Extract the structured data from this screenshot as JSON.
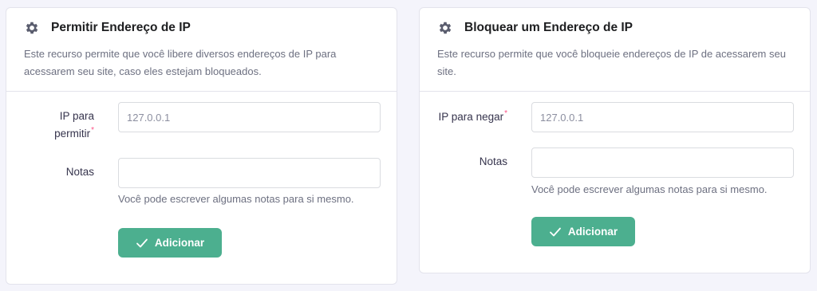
{
  "allow": {
    "title": "Permitir Endereço de IP",
    "description": "Este recurso permite que você libere diversos endereços de IP para acessarem seu site, caso eles estejam bloqueados.",
    "ip_label_line1": "IP para",
    "ip_label_line2": "permitir",
    "required_mark": "*",
    "ip_placeholder": "127.0.0.1",
    "notes_label": "Notas",
    "notes_hint": "Você pode escrever algumas notas para si mesmo.",
    "button_label": "Adicionar"
  },
  "block": {
    "title": "Bloquear um Endereço de IP",
    "description": "Este recurso permite que você bloqueie endereços de IP de acessarem seu site.",
    "ip_label": "IP para negar",
    "required_mark": "*",
    "ip_placeholder": "127.0.0.1",
    "notes_label": "Notas",
    "notes_hint": "Você pode escrever algumas notas para si mesmo.",
    "button_label": "Adicionar"
  },
  "icons": {
    "header": "gear-icon",
    "button": "check-icon"
  },
  "colors": {
    "primary_button": "#4caf8f",
    "required_asterisk": "#fc5185",
    "page_background": "#f4f4fb"
  }
}
